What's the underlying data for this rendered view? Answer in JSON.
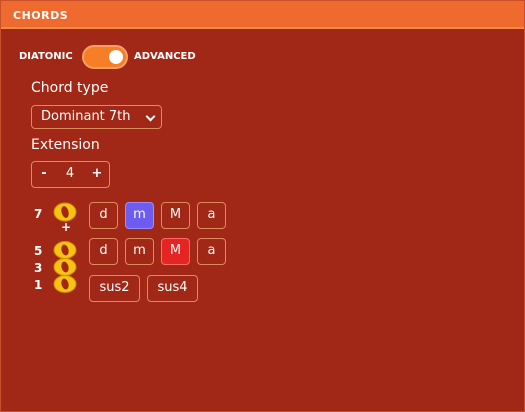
{
  "header": {
    "title": "CHORDS"
  },
  "mode": {
    "left_label": "DIATONIC",
    "right_label": "ADVANCED",
    "is_advanced": true
  },
  "chord_type": {
    "label": "Chord type",
    "selected": "Dominant 7th"
  },
  "extension": {
    "label": "Extension",
    "minus": "-",
    "value": "4",
    "plus": "+"
  },
  "degrees": {
    "seventh": "7",
    "plus": "+",
    "fifth": "5",
    "third": "3",
    "root": "1"
  },
  "seventh_row": {
    "buttons": [
      "d",
      "m",
      "M",
      "a"
    ],
    "selected": "m"
  },
  "fifth_row": {
    "buttons": [
      "d",
      "m",
      "M",
      "a"
    ],
    "selected": "M"
  },
  "sus_row": {
    "buttons": [
      "sus2",
      "sus4"
    ]
  },
  "colors": {
    "panel_bg": "#a12816",
    "header_bg": "#ef6a2e",
    "toggle_on": "#f57e26",
    "selected_seventh": "#6e5cf0",
    "selected_fifth": "#e52424",
    "notehead": "#f6c311"
  }
}
